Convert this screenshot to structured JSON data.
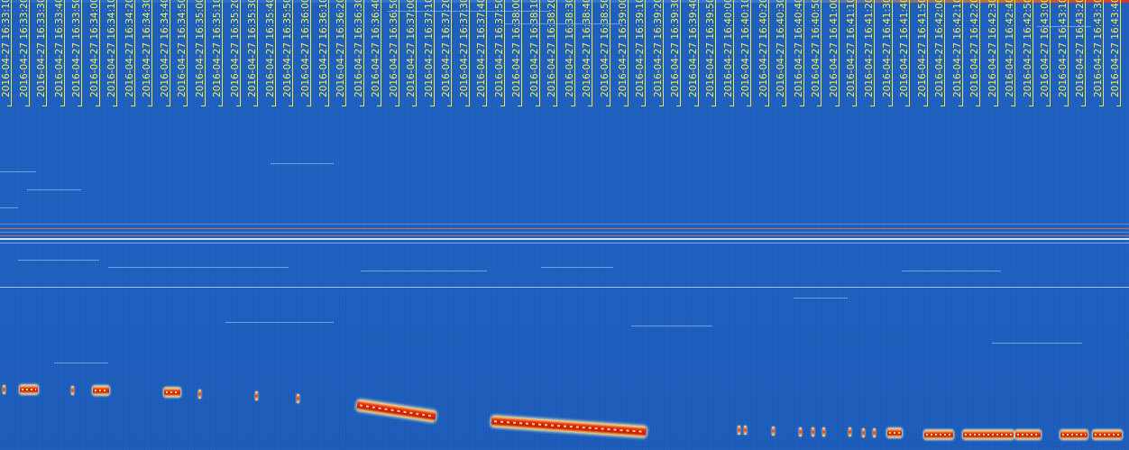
{
  "timestamps": [
    "2016-04-27 16:33:10",
    "2016-04-27 16:33:20",
    "2016-04-27 16:33:30",
    "2016-04-27 16:33:40",
    "2016-04-27 16:33:50",
    "2016-04-27 16:34:00",
    "2016-04-27 16:34:10",
    "2016-04-27 16:34:20",
    "2016-04-27 16:34:30",
    "2016-04-27 16:34:40",
    "2016-04-27 16:34:50",
    "2016-04-27 16:35:00",
    "2016-04-27 16:35:10",
    "2016-04-27 16:35:20",
    "2016-04-27 16:35:30",
    "2016-04-27 16:35:40",
    "2016-04-27 16:35:50",
    "2016-04-27 16:36:00",
    "2016-04-27 16:36:10",
    "2016-04-27 16:36:20",
    "2016-04-27 16:36:30",
    "2016-04-27 16:36:40",
    "2016-04-27 16:36:50",
    "2016-04-27 16:37:00",
    "2016-04-27 16:37:10",
    "2016-04-27 16:37:20",
    "2016-04-27 16:37:30",
    "2016-04-27 16:37:40",
    "2016-04-27 16:37:50",
    "2016-04-27 16:38:00",
    "2016-04-27 16:38:10",
    "2016-04-27 16:38:20",
    "2016-04-27 16:38:30",
    "2016-04-27 16:38:40",
    "2016-04-27 16:38:50",
    "2016-04-27 16:39:00",
    "2016-04-27 16:39:10",
    "2016-04-27 16:39:20",
    "2016-04-27 16:39:30",
    "2016-04-27 16:39:40",
    "2016-04-27 16:39:50",
    "2016-04-27 16:40:00",
    "2016-04-27 16:40:10",
    "2016-04-27 16:40:20",
    "2016-04-27 16:40:30",
    "2016-04-27 16:40:40",
    "2016-04-27 16:40:50",
    "2016-04-27 16:41:00",
    "2016-04-27 16:41:10",
    "2016-04-27 16:41:20",
    "2016-04-27 16:41:30",
    "2016-04-27 16:41:40",
    "2016-04-27 16:41:50",
    "2016-04-27 16:42:00",
    "2016-04-27 16:42:10",
    "2016-04-27 16:42:20",
    "2016-04-27 16:42:30",
    "2016-04-27 16:42:40",
    "2016-04-27 16:42:50",
    "2016-04-27 16:43:00",
    "2016-04-27 16:43:10",
    "2016-04-27 16:43:20",
    "2016-04-27 16:43:30",
    "2016-04-27 16:43:40"
  ],
  "colors": {
    "background": "#1d5fc0",
    "label": "#f4f050",
    "signal_hot": "#e23a1c",
    "signal_edge": "#f6e07a",
    "carrier_line": "#e07038"
  }
}
